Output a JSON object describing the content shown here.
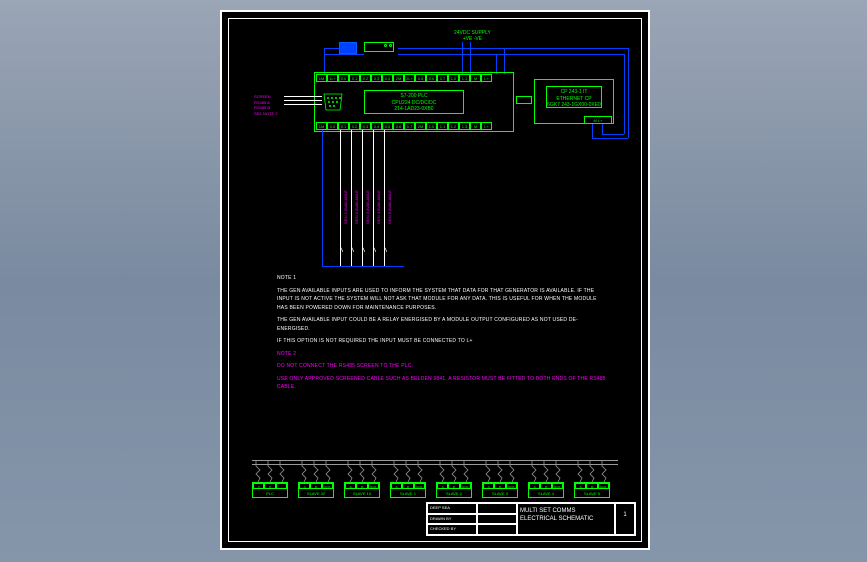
{
  "supply_label": "24VDC SUPPLY",
  "supply_pins": "+VE -VE",
  "plc": {
    "line1": "S7-200 PLC",
    "line2": "CPU224 DC/DC/DC",
    "line3": "214-1AD23-0XB0"
  },
  "cp": {
    "line1": "CP 243-1 IT",
    "line2": "ETHERNET CP",
    "line3": "6GK7 243-1GX00-0XE0"
  },
  "cp_bot_term": "M L+",
  "top_terminals": [
    "1M",
    "1L+",
    "0.0",
    "0.1",
    "0.2",
    "0.3",
    "0.4",
    "2M",
    "2L+",
    "0.5",
    "0.6",
    "0.7",
    "1.0",
    "1.1",
    "M",
    "L+"
  ],
  "bot_terminals": [
    "1M",
    "0.0",
    "0.1",
    "0.2",
    "0.3",
    "0.4",
    "0.5",
    "0.6",
    "0.7",
    "2M",
    "1.0",
    "1.1",
    "1.2",
    "1.3",
    "M",
    "L+"
  ],
  "side_labels": {
    "l1": "SCREEN",
    "l2": "RS485 A",
    "l3": "RS485 B",
    "l4": "SEE NOTE 2"
  },
  "gen_labels": [
    "GEN 1 AVAILABLE",
    "GEN 2 AVAILABLE",
    "GEN 3 AVAILABLE",
    "GEN 4 AVAILABLE",
    "GEN 5 AVAILABLE"
  ],
  "notes": {
    "title1": "NOTE 1",
    "p1": "THE GEN AVAILABLE INPUTS ARE USED TO INFORM THE SYSTEM THAT DATA FOR THAT GENERATOR IS AVAILABLE. IF THE INPUT IS NOT ACTIVE THE SYSTEM WILL NOT ASK THAT MODULE FOR ANY DATA. THIS IS USEFUL FOR WHEN THE MODULE HAS BEEN POWERED DOWN FOR MAINTENANCE PURPOSES.",
    "p2": "THE GEN AVAILABLE INPUT COULD BE A RELAY ENERGISED BY A MODULE OUTPUT CONFIGURED AS NOT USED DE-ENERGISED.",
    "p3": "IF THIS OPTION IS NOT REQUIRED THE INPUT MUST BE CONNECTED TO L+",
    "title2": "NOTE 2",
    "p4": "DO NOT CONNECT THE RS485 SCREEN TO THE PLC.",
    "p5": "USE ONLY APPROVED SCREENED CABLE SUCH AS BELDEN 9841. A RESISTOR MUST BE FITTED TO BOTH ENDS OF THE RS485 CABLE."
  },
  "slaves": [
    "PLC",
    "SLAVE 32",
    "SLAVE 10",
    "SLAVE 1",
    "SLAVE 2",
    "SLAVE 3",
    "SLAVE 4",
    "SLAVE 5"
  ],
  "slave_cells": [
    "A",
    "B",
    "SCR"
  ],
  "plc_cells": [
    "3",
    "8",
    "-"
  ],
  "title_block": {
    "company": "DEEP SEA",
    "drawn": "DRAWN BY",
    "checked": "CHECKED BY",
    "main": "MULTI SET COMMS ELECTRICAL SCHEMATIC",
    "page": "1"
  }
}
